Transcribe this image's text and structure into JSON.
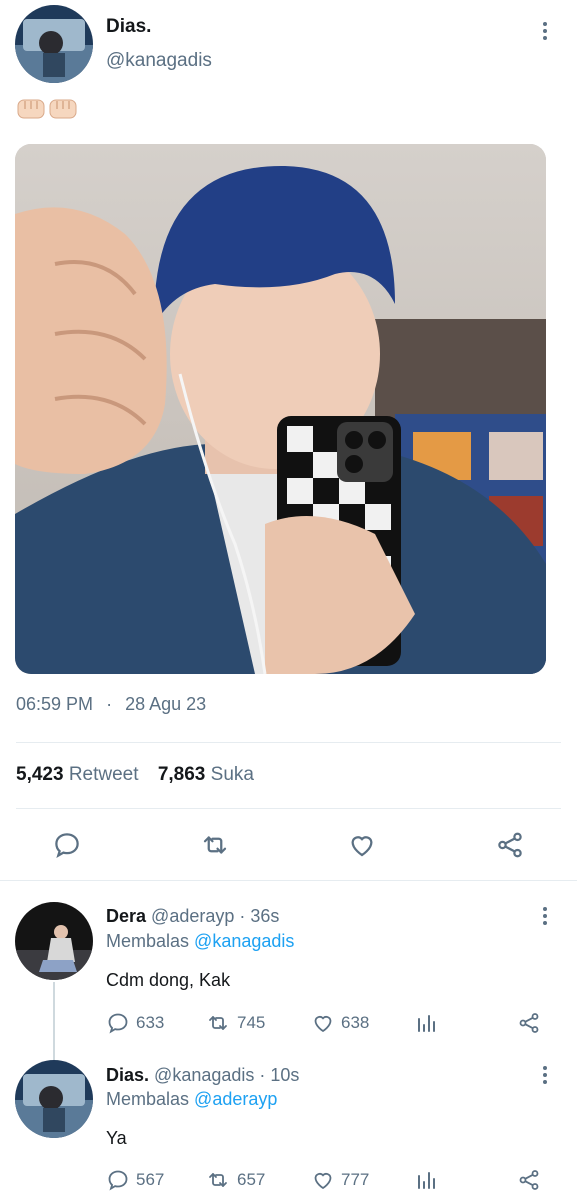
{
  "tweet": {
    "author_name": "Dias.",
    "author_handle": "@kanagadis",
    "emoji_text": "👊🏻👊🏻",
    "time": "06:59 PM",
    "separator": "·",
    "date": "28 Agu 23",
    "retweets_count": "5,423",
    "retweets_label": "Retweet",
    "likes_count": "7,863",
    "likes_label": "Suka"
  },
  "replies": [
    {
      "name": "Dera",
      "handle_time": "@aderayp · 36s",
      "replying_prefix": "Membalas",
      "replying_to": "@kanagadis",
      "text": "Cdm dong, Kak",
      "reply_count": "633",
      "retweet_count": "745",
      "like_count": "638"
    },
    {
      "name": "Dias.",
      "handle_time": "@kanagadis · 10s",
      "replying_prefix": "Membalas",
      "replying_to": "@aderayp",
      "text": "Ya",
      "reply_count": "567",
      "retweet_count": "657",
      "like_count": "777"
    }
  ],
  "icons": {
    "reply": "comment-icon",
    "retweet": "retweet-icon",
    "like": "heart-icon",
    "share": "share-icon",
    "analytics": "analytics-icon",
    "more": "more-vertical-icon"
  },
  "colors": {
    "link": "#1da1f2",
    "secondary_text": "#5b7083",
    "primary_text": "#14171a"
  }
}
